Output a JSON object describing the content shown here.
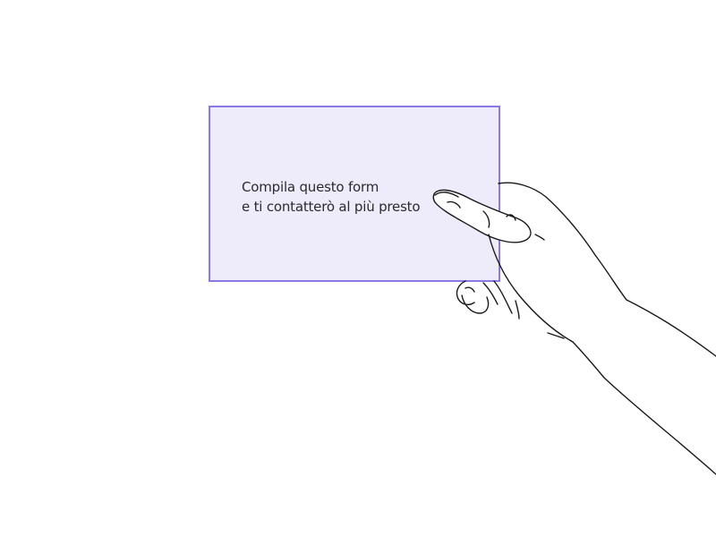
{
  "card": {
    "line1": "Compila questo form",
    "line2": "e ti contatterò al più presto"
  },
  "colors": {
    "card_fill": "#eeebfb",
    "card_border": "#8a79e0",
    "text": "#2b2b2b",
    "hand_stroke": "#1a1a1a",
    "background": "#ffffff"
  },
  "illustration": {
    "icon": "hand-holding-card"
  }
}
